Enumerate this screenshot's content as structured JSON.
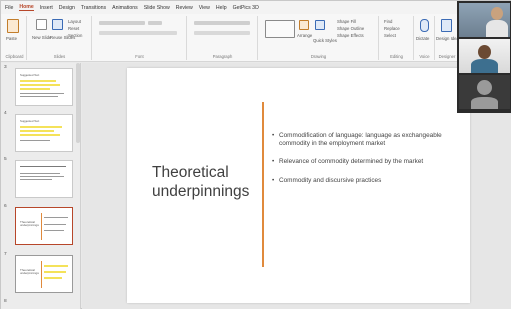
{
  "menu": {
    "items": [
      "File",
      "Home",
      "Insert",
      "Design",
      "Transitions",
      "Animations",
      "Slide Show",
      "Review",
      "View",
      "Help",
      "GetPics 3D"
    ],
    "active_index": 1
  },
  "ribbon": {
    "groups": [
      {
        "name": "clipboard",
        "label": "Clipboard",
        "buttons": [
          "Paste"
        ]
      },
      {
        "name": "slides",
        "label": "Slides",
        "buttons": [
          "New Slide",
          "Reuse Slides",
          "Layout",
          "Reset",
          "Section"
        ]
      },
      {
        "name": "font",
        "label": "Font",
        "buttons": []
      },
      {
        "name": "paragraph",
        "label": "Paragraph",
        "buttons": []
      },
      {
        "name": "drawing",
        "label": "Drawing",
        "buttons": [
          "Arrange",
          "Quick Styles",
          "Shape Fill",
          "Shape Outline",
          "Shape Effects"
        ]
      },
      {
        "name": "editing",
        "label": "Editing",
        "buttons": [
          "Find",
          "Replace",
          "Select"
        ]
      },
      {
        "name": "voice",
        "label": "Voice",
        "buttons": [
          "Dictate"
        ]
      },
      {
        "name": "designer",
        "label": "Designer",
        "buttons": [
          "Design Ideas"
        ]
      }
    ]
  },
  "thumbnails": {
    "items": [
      {
        "number": "3",
        "title": "Suggested Text",
        "selected": false
      },
      {
        "number": "4",
        "title": "Suggested Text",
        "selected": false
      },
      {
        "number": "5",
        "title": "",
        "selected": false
      },
      {
        "number": "6",
        "title": "Theoretical underpinnings",
        "selected": true
      },
      {
        "number": "7",
        "title": "Theoretical underpinnings",
        "selected": false
      },
      {
        "number": "8",
        "title": "",
        "selected": false
      }
    ]
  },
  "slide": {
    "title": "Theoretical underpinnings",
    "bullets": [
      "Commodification of language: language as exchangeable commodity in the employment market",
      "Relevance of commodity determined by the market",
      "Commodity and discursive practices"
    ],
    "accent_color": "#e08a3c"
  },
  "video_call": {
    "participants": [
      {
        "name": "",
        "camera": "on"
      },
      {
        "name": "",
        "camera": "on"
      },
      {
        "name": "",
        "camera": "off"
      }
    ]
  },
  "colors": {
    "app_accent": "#b7472a",
    "highlight": "#f4e25a"
  }
}
